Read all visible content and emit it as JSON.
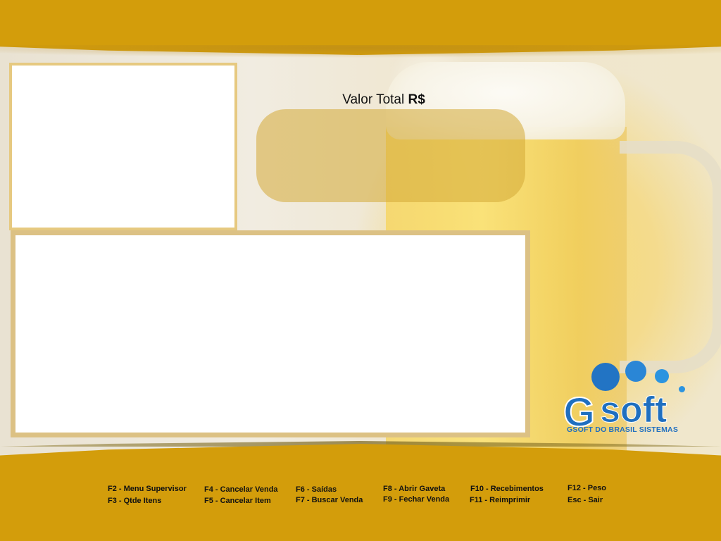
{
  "total": {
    "label_prefix": "Valor Total",
    "label_currency": "R$",
    "value": ""
  },
  "logo": {
    "letter": "G",
    "word": "soft",
    "tagline": "GSOFT DO BRASIL SISTEMAS"
  },
  "shortcuts": [
    {
      "key": "F2 - Menu Supervisor"
    },
    {
      "key": "F3 - Qtde Itens"
    },
    {
      "key": "F4 - Cancelar Venda"
    },
    {
      "key": "F5 - Cancelar Item"
    },
    {
      "key": "F6 - Saídas"
    },
    {
      "key": "F7 - Buscar Venda"
    },
    {
      "key": "F8 - Abrir Gaveta"
    },
    {
      "key": "F9 - Fechar Venda"
    },
    {
      "key": "F10 - Recebimentos"
    },
    {
      "key": "F11 - Reimprimir"
    },
    {
      "key": "F12 - Peso"
    },
    {
      "key": "Esc - Sair"
    }
  ],
  "colors": {
    "bar": "#d39d0b",
    "panel_border": "#dcc184",
    "logo_blue": "#1f6fc0"
  }
}
